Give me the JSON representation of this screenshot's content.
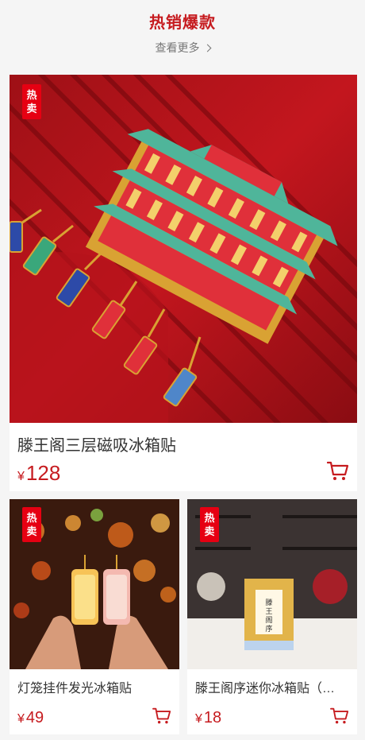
{
  "section": {
    "title": "热销爆款",
    "more_label": "查看更多"
  },
  "products": [
    {
      "badge_line1": "热",
      "badge_line2": "卖",
      "name": "滕王阁三层磁吸冰箱贴",
      "currency": "¥",
      "price": "128"
    },
    {
      "badge_line1": "热",
      "badge_line2": "卖",
      "name": "灯笼挂件发光冰箱贴",
      "currency": "¥",
      "price": "49"
    },
    {
      "badge_line1": "热",
      "badge_line2": "卖",
      "name": "滕王阁序迷你冰箱贴（…",
      "currency": "¥",
      "price": "18",
      "box_text": "滕王阁序"
    }
  ],
  "colors": {
    "accent": "#c61b1f",
    "badge": "#e60012"
  },
  "icons": [
    "chevron-right-icon",
    "cart-icon"
  ]
}
